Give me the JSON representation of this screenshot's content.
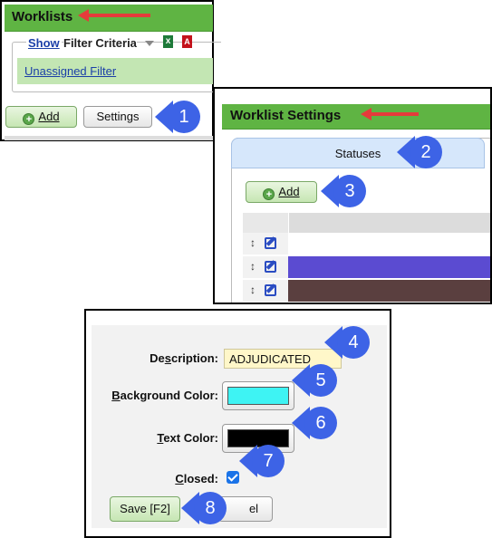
{
  "worklists_panel": {
    "title": "Worklists",
    "show_link": "Show",
    "filter_criteria_label": "Filter Criteria",
    "excel_icon": "excel-export-icon",
    "pdf_icon": "pdf-export-icon",
    "filter_link": "Unassigned Filter",
    "add_button": "Add",
    "settings_button": "Settings"
  },
  "settings_panel": {
    "title": "Worklist Settings",
    "tab_statuses": "Statuses",
    "add_button": "Add",
    "rows": [
      {
        "color": "#ffffff"
      },
      {
        "color": "#5b4bd1"
      },
      {
        "color": "#5a3f3f"
      }
    ]
  },
  "status_form": {
    "description_label": "Description:",
    "description_value": "ADJUDICATED",
    "background_color_label": "Background Color:",
    "background_color": "#3ef3f3",
    "text_color_label": "Text Color:",
    "text_color": "#000000",
    "closed_label": "Closed:",
    "closed_checked": true,
    "save_button": "Save [F2]",
    "cancel_button_visible": "el"
  },
  "callouts": [
    "1",
    "2",
    "3",
    "4",
    "5",
    "6",
    "7",
    "8"
  ],
  "colors": {
    "header_green": "#5fb443",
    "callout_blue": "#3d63e6",
    "arrow_red": "#e53b3b",
    "tab_blue": "#d6e7fb",
    "description_bg": "#fff7c9"
  }
}
